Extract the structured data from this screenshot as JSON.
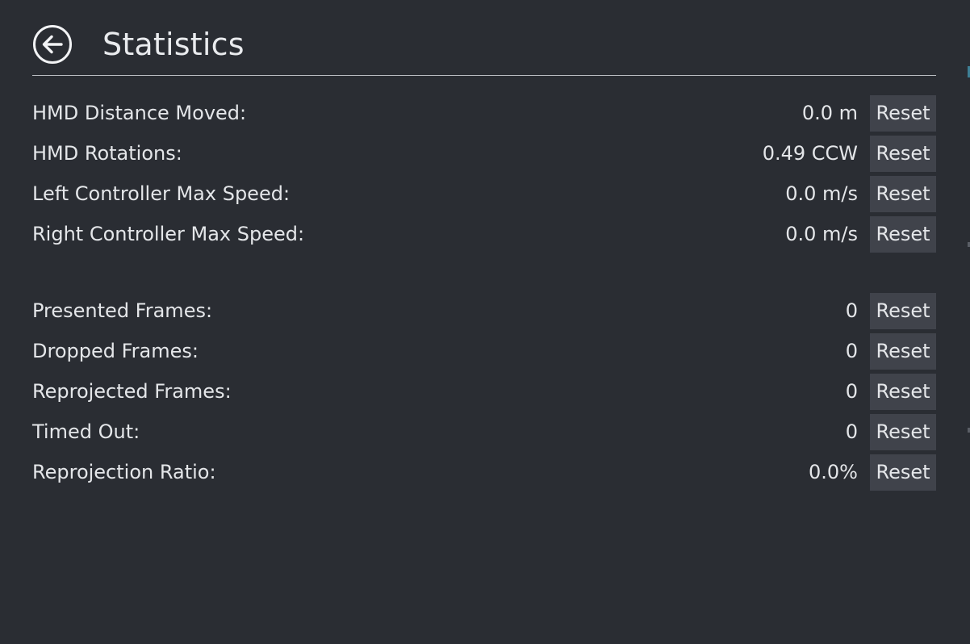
{
  "header": {
    "title": "Statistics",
    "back_icon": "arrow-left-circle-icon"
  },
  "motion_stats": [
    {
      "label": "HMD Distance Moved:",
      "value": "0.0 m",
      "reset_label": "Reset"
    },
    {
      "label": "HMD Rotations:",
      "value": "0.49 CCW",
      "reset_label": "Reset"
    },
    {
      "label": "Left Controller Max Speed:",
      "value": "0.0 m/s",
      "reset_label": "Reset"
    },
    {
      "label": "Right Controller Max Speed:",
      "value": "0.0 m/s",
      "reset_label": "Reset"
    }
  ],
  "frame_stats": [
    {
      "label": "Presented Frames:",
      "value": "0",
      "reset_label": "Reset"
    },
    {
      "label": "Dropped Frames:",
      "value": "0",
      "reset_label": "Reset"
    },
    {
      "label": "Reprojected Frames:",
      "value": "0",
      "reset_label": "Reset"
    },
    {
      "label": "Timed Out:",
      "value": "0",
      "reset_label": "Reset"
    },
    {
      "label": "Reprojection Ratio:",
      "value": "0.0%",
      "reset_label": "Reset"
    }
  ],
  "colors": {
    "background": "#2a2d33",
    "button_bg": "#40434b",
    "text": "#e4e6e9",
    "divider": "#b9bcc1"
  }
}
